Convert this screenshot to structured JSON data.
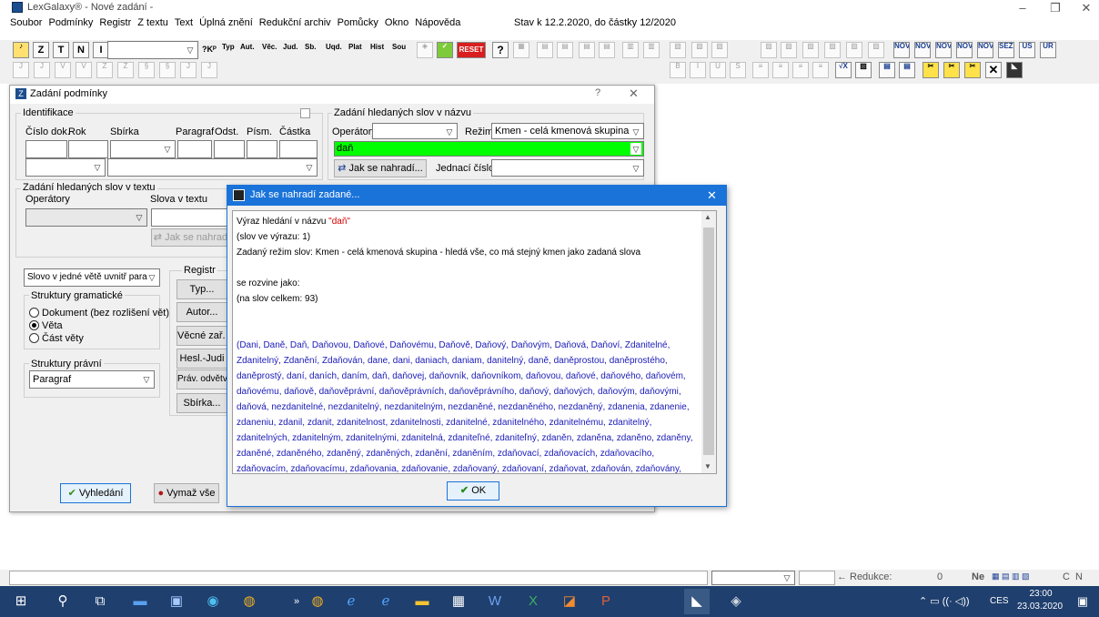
{
  "app": {
    "title": "LexGalaxy® - Nové zadání -"
  },
  "menu": [
    "Soubor",
    "Podmínky",
    "Registr",
    "Z textu",
    "Text",
    "Úplná znění",
    "Redukční archiv",
    "Pomůcky",
    "Okno",
    "Nápověda"
  ],
  "menu_status": "Stav k 12.2.2020, do částky 12/2020",
  "toolbar1": {
    "labels": [
      "Z",
      "T",
      "N",
      "I"
    ],
    "small_labels": [
      "Typ",
      "Aut.",
      "Věc.",
      "Jud.",
      "Sb.",
      "Uqd.",
      "Plat",
      "Hist",
      "Sou"
    ],
    "reset": "RESET",
    "new_labels": [
      "NOVÉ",
      "NOVÉ",
      "NOVÉ",
      "NOVÉ",
      "NOVÉ",
      "SEZN."
    ]
  },
  "dialog1": {
    "title": "Zadání podmínky",
    "identifikace": "Identifikace",
    "cols": [
      "Číslo dok.",
      "Rok",
      "Sbírka",
      "Paragraf",
      "Odst.",
      "Písm.",
      "Částka"
    ],
    "zadani_nazev": "Zadání hledaných slov v názvu",
    "operatory": "Operátory",
    "rezim_label": "Režim",
    "rezim_value": "Kmen - celá kmenová skupina",
    "nazev_value": "daň",
    "jak_button": "Jak se nahradí...",
    "jednaci_label": "Jednací číslo",
    "zadani_text": "Zadání hledaných slov v textu",
    "operatory2": "Operátory",
    "slova_label": "Slova v textu",
    "jak_button2": "Jak se nahradí",
    "slovo_select": "Slovo v jedné větě uvnitř para",
    "struktury_gram": "Struktury gramatické",
    "radios": [
      {
        "label": "Dokument (bez rozlišení vět)",
        "on": false
      },
      {
        "label": "Věta",
        "on": true
      },
      {
        "label": "Část věty",
        "on": false
      }
    ],
    "struktury_pravni": "Struktury právní",
    "paragraf_select": "Paragraf",
    "registr": "Registr",
    "reg_buttons": [
      "Typ...",
      "Autor...",
      "Věcné zař. S",
      "Hesl.-Judi",
      "Práv. odvětví",
      "Sbírka..."
    ],
    "vyhledani": "Vyhledání",
    "vymaz": "Vymaž vše"
  },
  "dialog2": {
    "title": "Jak se nahradí zadané...",
    "line1_pre": "Výraz hledání v názvu ",
    "line1_word": "\"daň\"",
    "line2": "(slov ve výrazu: 1)",
    "line3": "Zadaný režim slov: Kmen - celá kmenová skupina - hledá vše, co má stejný kmen jako zadaná slova",
    "line4": "se rozvine jako:",
    "line5": "(na slov celkem: 93)",
    "words": "(Dani, Daně, Daň, Daňovou, Daňové, Daňovému, Daňově, Daňový, Daňovým, Daňová, Daňoví, Zdanitelné, Zdanitelný, Zdanění, Zdaňován, dane, dani, daniach, daniam, danitelný, daně, daněprostou, daněprostého, daněprostý, daní, daních, daním, daň, daňovej, daňovník, daňovníkom, daňovou, daňové, daňového, daňovém, daňovému, daňově, daňověprávní, daňověprávních, daňověprávního, daňový, daňových, daňovým, daňovými, daňová, nezdanitelné, nezdanitelný, nezdanitelným, nezdaněné, nezdaněného, nezdaněný, zdanenia, zdanenie, zdaneniu, zdanil, zdanit, zdanitelnost, zdanitelnosti, zdanitelné, zdanitelného, zdanitelnému, zdanitelný, zdanitelných, zdanitelným, zdanitelnými, zdanitelná, zdaniteľné, zdaniteľný, zdaněn, zdaněna, zdaněno, zdaněny, zdaněné, zdaněného, zdaněný, zdaněných, zdanění, zdaněním, zdaňovací, zdaňovacích, zdaňovacího, zdaňovacím, zdaňovacímu, zdaňovania, zdaňovanie, zdaňovaný, zdaňovaní, zdaňovat, zdaňován, zdaňovány, zdaňování, zdaňuje, zdaňují)",
    "ok": "OK"
  },
  "status": {
    "redukce_label": "Redukce:",
    "redukce_value": "0",
    "ne": "Ne",
    "c": "C",
    "n": "N"
  },
  "taskbar": {
    "lang": "CES",
    "time": "23:00",
    "date": "23.03.2020"
  },
  "colors": {
    "accent": "#1a73d9",
    "green_field": "#00ff00",
    "word_blue": "#1a1ab8",
    "word_red": "#d40000"
  }
}
